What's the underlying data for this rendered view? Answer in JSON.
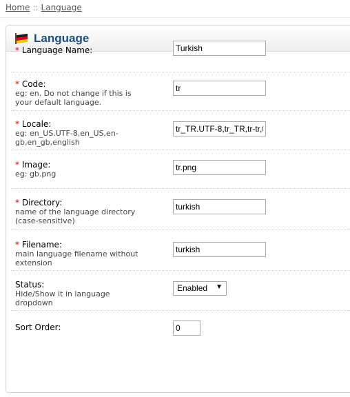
{
  "breadcrumb": {
    "home": "Home",
    "separator": "::",
    "current": "Language"
  },
  "panel": {
    "title": "Language",
    "flag_icon": "germany-flag-icon"
  },
  "form": {
    "required_mark": "*",
    "language_name": {
      "label": "Language Name:",
      "value": "Turkish"
    },
    "code": {
      "label": "Code:",
      "help": "eg: en. Do not change if this is your default language.",
      "value": "tr"
    },
    "locale": {
      "label": "Locale:",
      "help": "eg: en_US.UTF-8,en_US,en-gb,en_gb,english",
      "value": "tr_TR.UTF-8,tr_TR,tr-tr,t"
    },
    "image": {
      "label": "Image:",
      "help": "eg: gb.png",
      "value": "tr.png"
    },
    "directory": {
      "label": "Directory:",
      "help": "name of the language directory (case-sensitive)",
      "value": "turkish"
    },
    "filename": {
      "label": "Filename:",
      "help": "main language filename without extension",
      "value": "turkish"
    },
    "status": {
      "label": "Status:",
      "help": "Hide/Show it in language dropdown",
      "value": "Enabled"
    },
    "sort_order": {
      "label": "Sort Order:",
      "value": "0"
    }
  }
}
